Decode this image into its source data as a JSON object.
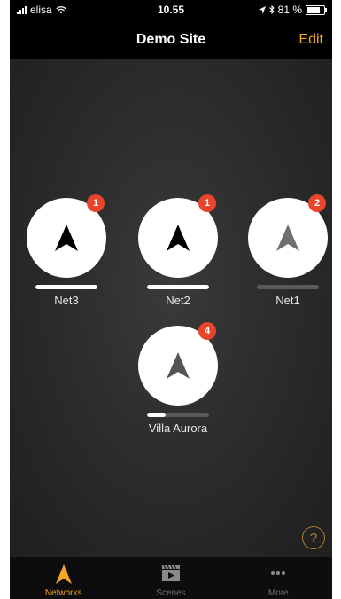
{
  "status_bar": {
    "carrier": "elisa",
    "time": "10.55",
    "battery": "81 %"
  },
  "nav": {
    "title": "Demo Site",
    "edit_label": "Edit"
  },
  "networks": [
    {
      "name": "Net3",
      "badge": "1",
      "level": 1.0,
      "icon_color": "#000000"
    },
    {
      "name": "Net2",
      "badge": "1",
      "level": 1.0,
      "icon_color": "#000000"
    },
    {
      "name": "Net1",
      "badge": "2",
      "level": 0.0,
      "icon_color": "#6f6f6f"
    },
    {
      "name": "Villa Aurora",
      "badge": "4",
      "level": 0.3,
      "icon_color": "#555555"
    }
  ],
  "help": {
    "label": "?"
  },
  "tabs": [
    {
      "label": "Networks",
      "icon": "network-arrow-icon",
      "active": true
    },
    {
      "label": "Scenes",
      "icon": "scenes-clapper-icon",
      "active": false
    },
    {
      "label": "More",
      "icon": "more-dots-icon",
      "active": false
    }
  ],
  "colors": {
    "accent": "#f5a623",
    "badge": "#e8452c"
  }
}
